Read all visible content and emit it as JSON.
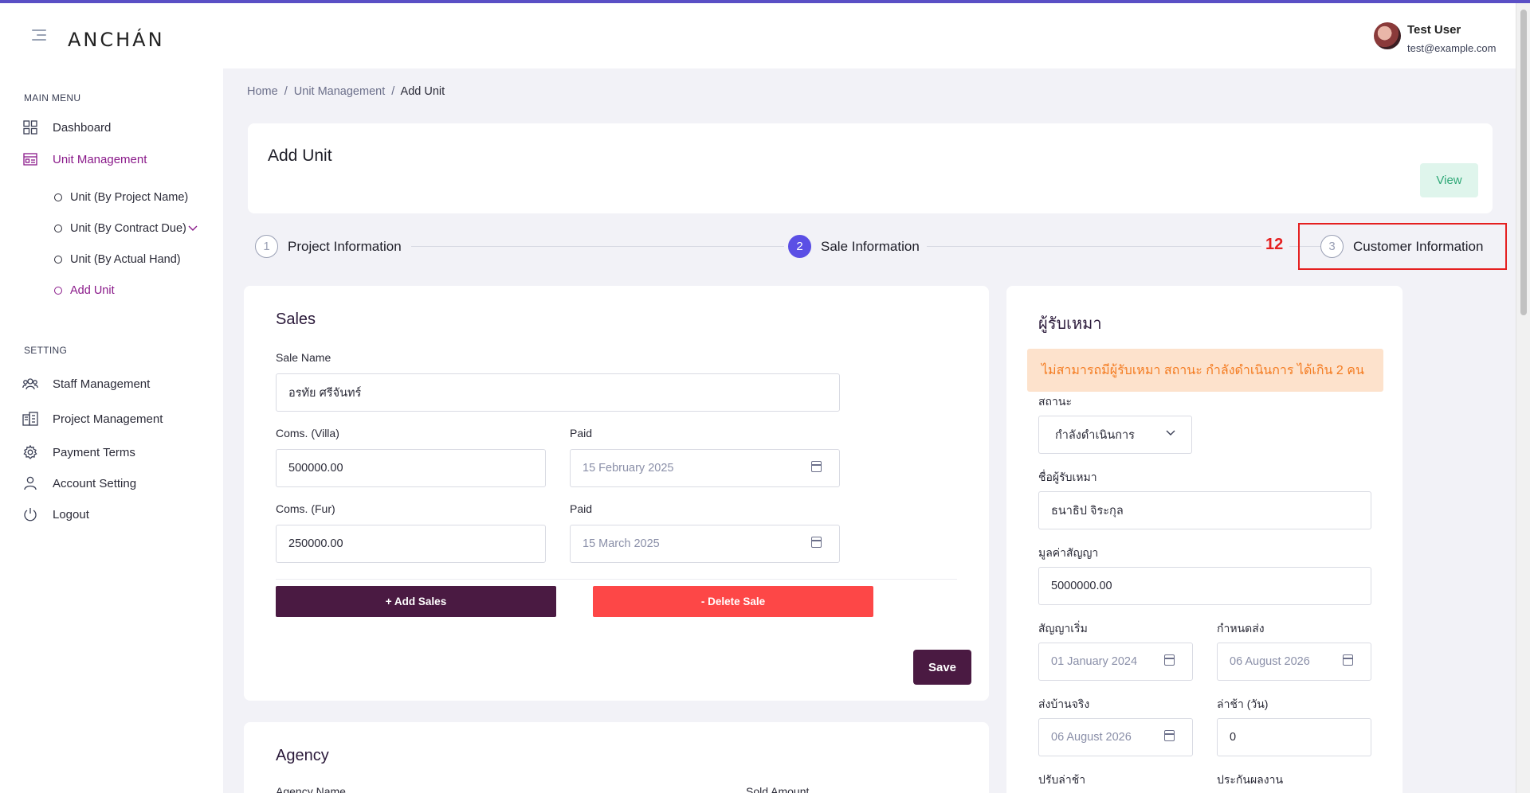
{
  "header": {
    "logo": "ANCHÁN",
    "user_name": "Test User",
    "user_email": "test@example.com"
  },
  "sidebar": {
    "main_menu_title": "MAIN MENU",
    "setting_title": "SETTING",
    "items": {
      "dashboard": "Dashboard",
      "unit_management": "Unit Management",
      "staff_management": "Staff Management",
      "project_management": "Project Management",
      "payment_terms": "Payment Terms",
      "account_setting": "Account Setting",
      "logout": "Logout"
    },
    "sub_items": {
      "by_project": "Unit (By Project Name)",
      "by_contract": "Unit (By Contract Due)",
      "by_actual": "Unit (By Actual Hand)",
      "add_unit": "Add Unit"
    }
  },
  "breadcrumb": {
    "home": "Home",
    "unit_management": "Unit Management",
    "current": "Add Unit",
    "sep1": "/",
    "sep2": "/"
  },
  "page": {
    "title": "Add Unit",
    "view_button": "View"
  },
  "steps": {
    "step1_num": "1",
    "step1_label": "Project Information",
    "step2_num": "2",
    "step2_label": "Sale Information",
    "step3_num": "3",
    "step3_label": "Customer Information",
    "annotation": "12"
  },
  "sales": {
    "title": "Sales",
    "sale_name_label": "Sale Name",
    "sale_name_value": "อรทัย ศรีจันทร์",
    "coms_villa_label": "Coms. (Villa)",
    "coms_villa_value": "500000.00",
    "paid_label_1": "Paid",
    "paid_value_1": "15 February 2025",
    "coms_fur_label": "Coms. (Fur)",
    "coms_fur_value": "250000.00",
    "paid_label_2": "Paid",
    "paid_value_2": "15 March 2025",
    "add_button": "+ Add Sales",
    "delete_button": "- Delete Sale",
    "save_button": "Save"
  },
  "agency": {
    "title": "Agency",
    "agency_name_label": "Agency Name",
    "sold_amount_label": "Sold Amount"
  },
  "customer": {
    "title": "ผู้รับเหมา",
    "alert": "ไม่สามารถมีผู้รับเหมา สถานะ กำลังดำเนินการ ได้เกิน 2 คน",
    "status_label": "สถานะ",
    "status_value": "กำลังดำเนินการ",
    "name_label": "ชื่อผู้รับเหมา",
    "name_value": "ธนาธิป จิระกุล",
    "contract_value_label": "มูลค่าสัญญา",
    "contract_value": "5000000.00",
    "start_label": "สัญญาเริ่ม",
    "start_value": "01 January 2024",
    "due_label": "กำหนดส่ง",
    "due_value": "06 August 2026",
    "actual_label": "ส่งบ้านจริง",
    "actual_value": "06 August 2026",
    "late_label": "ล่าช้า (วัน)",
    "late_value": "0",
    "penalty_label": "ปรับล่าช้า",
    "warranty_label": "ประกันผลงาน"
  }
}
